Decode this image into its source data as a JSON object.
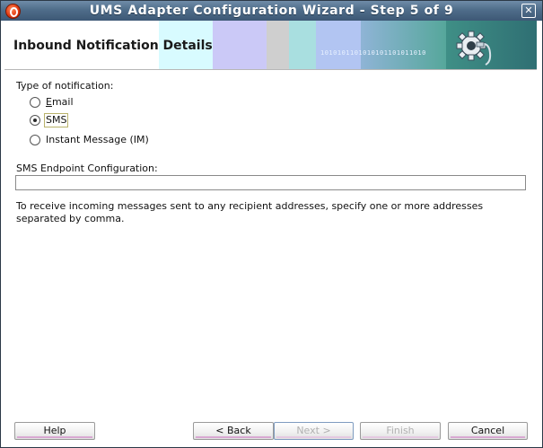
{
  "window": {
    "title": "UMS Adapter Configuration Wizard - Step 5 of 9",
    "close_glyph": "✕"
  },
  "header": {
    "title": "Inbound Notification Details",
    "binary_decoration": "1010101101010101101011010"
  },
  "form": {
    "type_label": "Type of notification:",
    "options": [
      {
        "label": "Email",
        "selected": false
      },
      {
        "label": "SMS",
        "selected": true
      },
      {
        "label": "Instant Message (IM)",
        "selected": false
      }
    ],
    "endpoint_label": "SMS Endpoint Configuration:",
    "endpoint_value": "",
    "help_text": "To receive incoming messages sent to any recipient addresses, specify one or more addresses separated by comma."
  },
  "buttons": {
    "help": "Help",
    "back": "< Back",
    "next": "Next >",
    "finish": "Finish",
    "cancel": "Cancel"
  },
  "icons": {
    "app": "oracle-logo-icon",
    "close": "close-icon",
    "wizard": "gear-plug-icon"
  },
  "colors": {
    "titlebar": "#4f6d8a",
    "accent_underline": "#d9a8d2"
  }
}
